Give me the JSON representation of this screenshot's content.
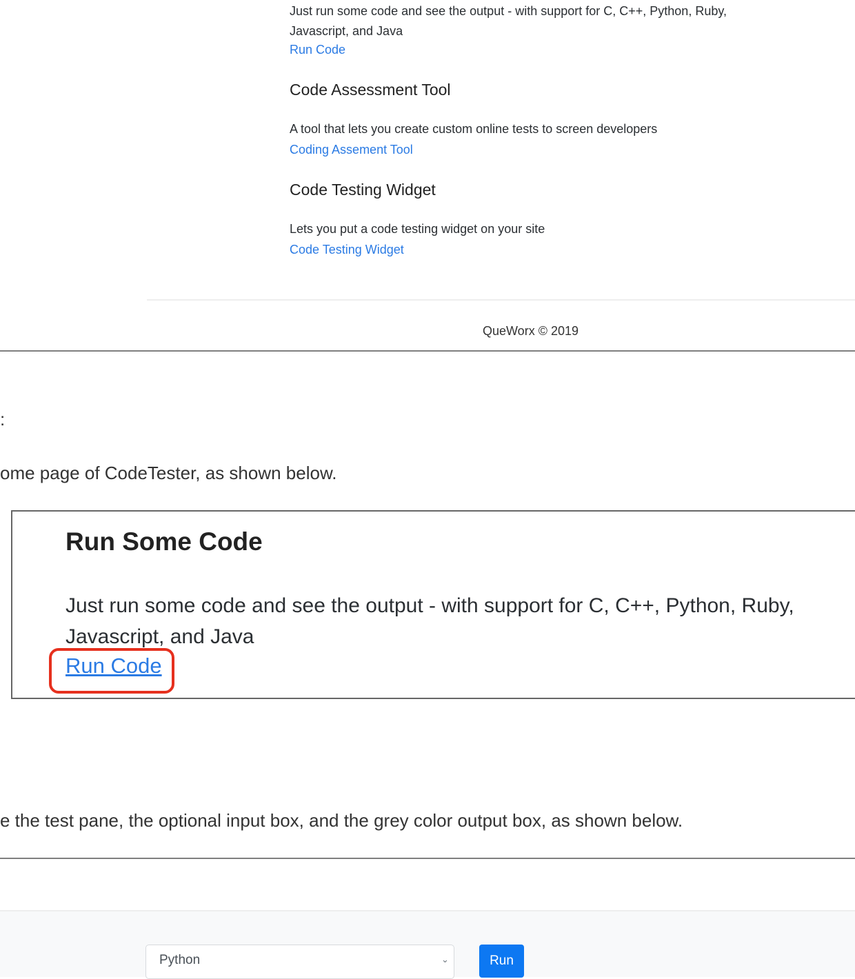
{
  "top_screenshot": {
    "run_desc": "Just run some code and see the output - with support for C, C++, Python, Ruby, Javascript, and Java",
    "run_link": "Run Code",
    "assessment_heading": "Code Assessment Tool",
    "assessment_desc": "A tool that lets you create custom online tests to screen developers",
    "assessment_link": "Coding Assement Tool",
    "widget_heading": "Code Testing Widget",
    "widget_desc": "Lets you put a code testing widget on your site",
    "widget_link": "Code Testing Widget",
    "footer": "QueWorx © 2019"
  },
  "doc": {
    "cutoff_colon": ":",
    "step_text": "ome page of CodeTester, as shown below.",
    "box": {
      "title": "Run Some Code",
      "desc": "Just run some code and see the output - with support for C, C++, Python, Ruby, Javascript, and Java",
      "link": "Run Code"
    },
    "step2_text": "e the test pane, the optional input box, and the grey color output box, as shown below."
  },
  "editor_bar": {
    "language_selected": "Python",
    "run_label": "Run"
  },
  "colors": {
    "link": "#2b7be4",
    "highlight": "#e6301e",
    "run_button": "#0d78f2"
  }
}
